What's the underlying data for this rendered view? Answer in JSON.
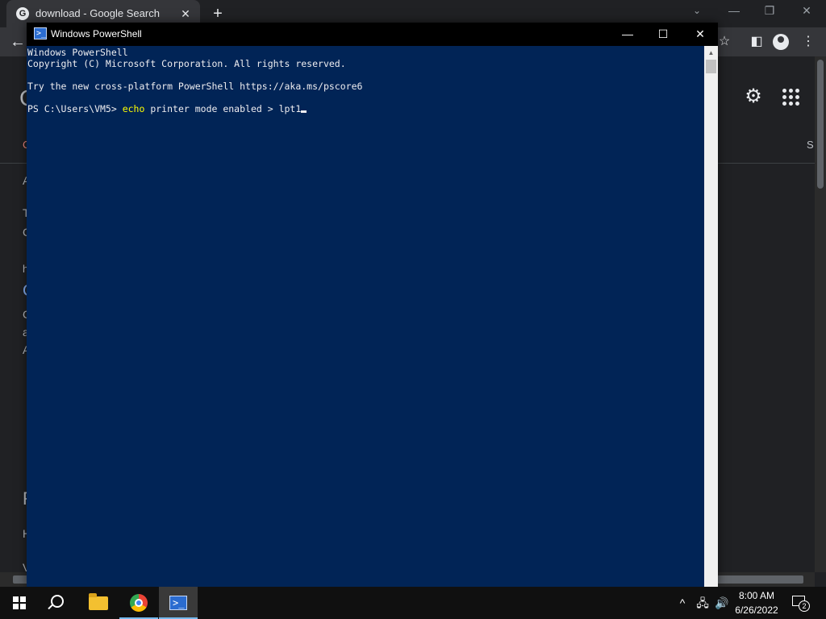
{
  "browser": {
    "tab": {
      "favicon": "G",
      "title": "download - Google Search",
      "close_glyph": "✕"
    },
    "new_tab_glyph": "+",
    "tab_search_glyph": "⌄",
    "window_controls": {
      "minimize": "—",
      "restore": "❐",
      "close": "✕"
    },
    "toolbar": {
      "back_glyph": "←",
      "star_glyph": "☆",
      "sidebar_glyph": "◧",
      "menu_glyph": "⋮"
    },
    "page": {
      "gear_glyph": "⚙",
      "fragments": [
        "C",
        "C",
        "S",
        "A",
        "T",
        "C",
        "h",
        "C",
        "C",
        "a",
        "A",
        "F",
        "H",
        "V"
      ]
    }
  },
  "powershell": {
    "window_title": "Windows PowerShell",
    "icon": "icon-powershell",
    "controls": {
      "minimize": "—",
      "maximize": "☐",
      "close": "✕"
    },
    "lines": [
      "Windows PowerShell",
      "Copyright (C) Microsoft Corporation. All rights reserved.",
      "",
      "Try the new cross-platform PowerShell https://aka.ms/pscore6",
      ""
    ],
    "prompt": "PS C:\\Users\\VM5> ",
    "command_keyword": "echo",
    "command_rest": " printer mode enabled > lpt1",
    "colors": {
      "background": "#012456",
      "text": "#eeedf0",
      "keyword": "#ffff00"
    }
  },
  "taskbar": {
    "items": [
      "start-icon",
      "search-icon",
      "file-explorer-icon",
      "chrome-icon",
      "powershell-icon"
    ],
    "active_item": "powershell-icon",
    "tray": {
      "chevron": "^",
      "network": "🖧",
      "volume": "🔊"
    },
    "clock": {
      "time": "8:00 AM",
      "date": "6/26/2022"
    },
    "notification_count": "2"
  }
}
